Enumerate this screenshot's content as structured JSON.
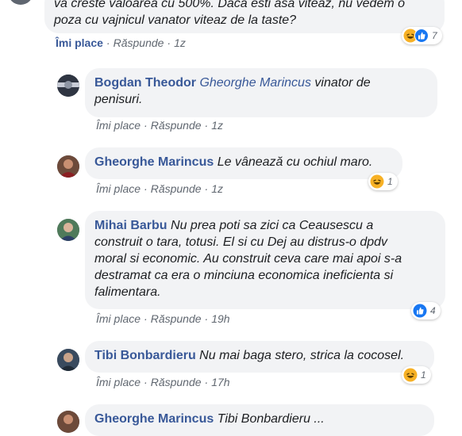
{
  "top_comment": {
    "text_line1": "va creste valoarea cu 500%. Daca esti asa viteaz, nu vedem o",
    "text_line2": "poza cu vajnicul vanator viteaz de la taste?",
    "like": "Îmi place",
    "reply": "Răspunde",
    "time": "1z",
    "reactions": {
      "icons": [
        "haha-icon",
        "like-icon"
      ],
      "count": "7"
    }
  },
  "replies": [
    {
      "author": "Bogdan Theodor",
      "mention": "Gheorghe Marincus",
      "text_line1": "vinator de",
      "text_line2": "penisuri.",
      "like": "Îmi place",
      "reply": "Răspunde",
      "time": "1z"
    },
    {
      "author": "Gheorghe Marincus",
      "text": "Le vânează cu ochiul maro.",
      "like": "Îmi place",
      "reply": "Răspunde",
      "time": "1z",
      "reactions": {
        "icons": [
          "haha-icon"
        ],
        "count": "1"
      }
    },
    {
      "author": "Mihai Barbu",
      "text_line1": "Nu prea poti sa zici ca Ceausescu a",
      "text_line2": "construit o tara, totusi. El si cu Dej au distrus-o dpdv",
      "text_line3": "moral si economic. Au construit ceva care mai apoi s-a",
      "text_line4": "destramat ca era o minciuna economica ineficienta si",
      "text_line5": "falimentara.",
      "like": "Îmi place",
      "reply": "Răspunde",
      "time": "19h",
      "reactions": {
        "icons": [
          "like-icon"
        ],
        "count": "4"
      }
    },
    {
      "author": "Tibi Bonbardieru",
      "text": "Nu mai baga stero, strica la cocosel.",
      "like": "Îmi place",
      "reply": "Răspunde",
      "time": "17h",
      "reactions": {
        "icons": [
          "haha-icon"
        ],
        "count": "1"
      }
    },
    {
      "author": "Gheorghe Marincus",
      "text": "Tibi Bonbardieru ..."
    }
  ],
  "colors": {
    "link": "#385898",
    "bubble": "#f2f3f5",
    "meta": "#606770",
    "like_blue": "#1877f2",
    "haha_yellow": "#f7b125"
  }
}
